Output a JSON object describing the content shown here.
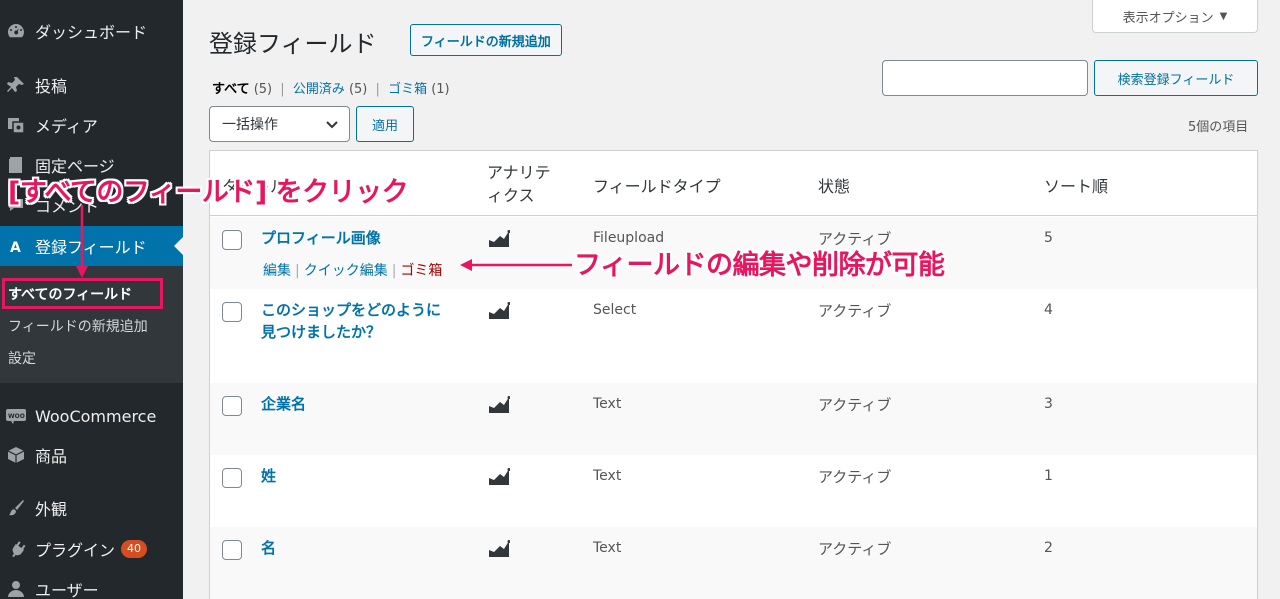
{
  "sidebar": {
    "items": [
      {
        "label": "ダッシュボード",
        "icon": "dashboard-icon"
      },
      {
        "label": "投稿",
        "icon": "pin-icon"
      },
      {
        "label": "メディア",
        "icon": "media-icon"
      },
      {
        "label": "固定ページ",
        "icon": "page-icon"
      },
      {
        "label": "コメント",
        "icon": "comment-icon"
      },
      {
        "label": "登録フィールド",
        "icon": "registration-fields-icon"
      },
      {
        "label": "WooCommerce",
        "icon": "woocommerce-icon"
      },
      {
        "label": "商品",
        "icon": "box-icon"
      },
      {
        "label": "外観",
        "icon": "brush-icon"
      },
      {
        "label": "プラグイン",
        "icon": "plugin-icon",
        "badge": "40"
      },
      {
        "label": "ユーザー",
        "icon": "user-icon"
      }
    ],
    "submenu": [
      {
        "label": "すべてのフィールド"
      },
      {
        "label": "フィールドの新規追加"
      },
      {
        "label": "設定"
      }
    ]
  },
  "header": {
    "title": "登録フィールド",
    "add_new": "フィールドの新規追加",
    "screen_options": "表示オプション"
  },
  "views": {
    "all": "すべて",
    "all_count": "(5)",
    "published": "公開済み",
    "published_count": "(5)",
    "trash": "ゴミ箱",
    "trash_count": "(1)"
  },
  "search": {
    "value": "",
    "button": "検索登録フィールド"
  },
  "bulk": {
    "selected": "一括操作",
    "apply": "適用"
  },
  "items_count": "5個の項目",
  "table": {
    "columns": {
      "title": "タイトル",
      "analytics_1": "アナリテ",
      "analytics_2": "ィクス",
      "field_type": "フィールドタイプ",
      "status": "状態",
      "sort_order": "ソート順"
    },
    "row_actions": {
      "edit": "編集",
      "quick_edit": "クイック編集",
      "trash": "ゴミ箱"
    },
    "rows": [
      {
        "title_1": "プロフィール画像",
        "title_2": "",
        "type": "Fileupload",
        "status": "アクティブ",
        "sort": "5"
      },
      {
        "title_1": "このショップをどのように",
        "title_2": "見つけましたか？",
        "type": "Select",
        "status": "アクティブ",
        "sort": "4"
      },
      {
        "title_1": "企業名",
        "title_2": "",
        "type": "Text",
        "status": "アクティブ",
        "sort": "3"
      },
      {
        "title_1": "姓",
        "title_2": "",
        "type": "Text",
        "status": "アクティブ",
        "sort": "1"
      },
      {
        "title_1": "名",
        "title_2": "",
        "type": "Text",
        "status": "アクティブ",
        "sort": "2"
      }
    ]
  },
  "annotations": {
    "click_all_fields": "[すべてのフィールド] をクリック",
    "edit_or_delete": "フィールドの編集や削除が可能",
    "color": "#e6175f"
  }
}
